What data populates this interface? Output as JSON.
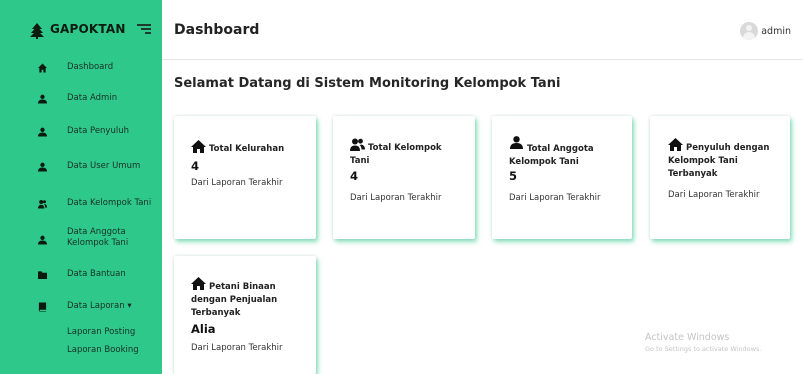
{
  "sidebar": {
    "brand": "GAPOKTAN",
    "items": [
      {
        "label": "Dashboard",
        "icon": "home-icon"
      },
      {
        "label": "Data Admin",
        "icon": "user-icon"
      },
      {
        "label": "Data Penyuluh",
        "icon": "user-icon"
      },
      {
        "label": "Data User Umum",
        "icon": "user-icon"
      },
      {
        "label": "Data Kelompok Tani",
        "icon": "users-icon"
      },
      {
        "label": "Data Anggota Kelompok Tani",
        "icon": "user-icon"
      },
      {
        "label": "Data Bantuan",
        "icon": "folder-icon"
      },
      {
        "label": "Data Laporan",
        "icon": "book-icon"
      }
    ],
    "laporan_caret": "▾",
    "subitems": [
      "Laporan Posting",
      "Laporan Booking"
    ]
  },
  "header": {
    "title": "Dashboard",
    "user": "admin"
  },
  "main": {
    "welcome": "Selamat Datang di Sistem Monitoring Kelompok Tani",
    "cards": [
      {
        "title": "Total Kelurahan",
        "value": "4",
        "sub": "Dari Laporan Terakhir",
        "icon": "home-icon"
      },
      {
        "title": "Total Kelompok Tani",
        "value": "4",
        "sub": "Dari Laporan Terakhir",
        "icon": "users-icon"
      },
      {
        "title": "Total Anggota Kelompok Tani",
        "value": "5",
        "sub": "Dari Laporan Terakhir",
        "icon": "user-icon"
      },
      {
        "title": "Penyuluh dengan Kelompok Tani Terbanyak",
        "value": "",
        "sub": "Dari Laporan Terakhir",
        "icon": "home-icon"
      },
      {
        "title": "Petani Binaan dengan Penjualan Terbanyak",
        "value": "Alia",
        "sub": "Dari Laporan Terakhir",
        "icon": "home-icon"
      }
    ]
  },
  "watermark": {
    "line1": "Activate Windows",
    "line2": "Go to Settings to activate Windows."
  },
  "colors": {
    "sidebar_bg": "#2ec98a",
    "card_glow": "#2ec98a"
  }
}
